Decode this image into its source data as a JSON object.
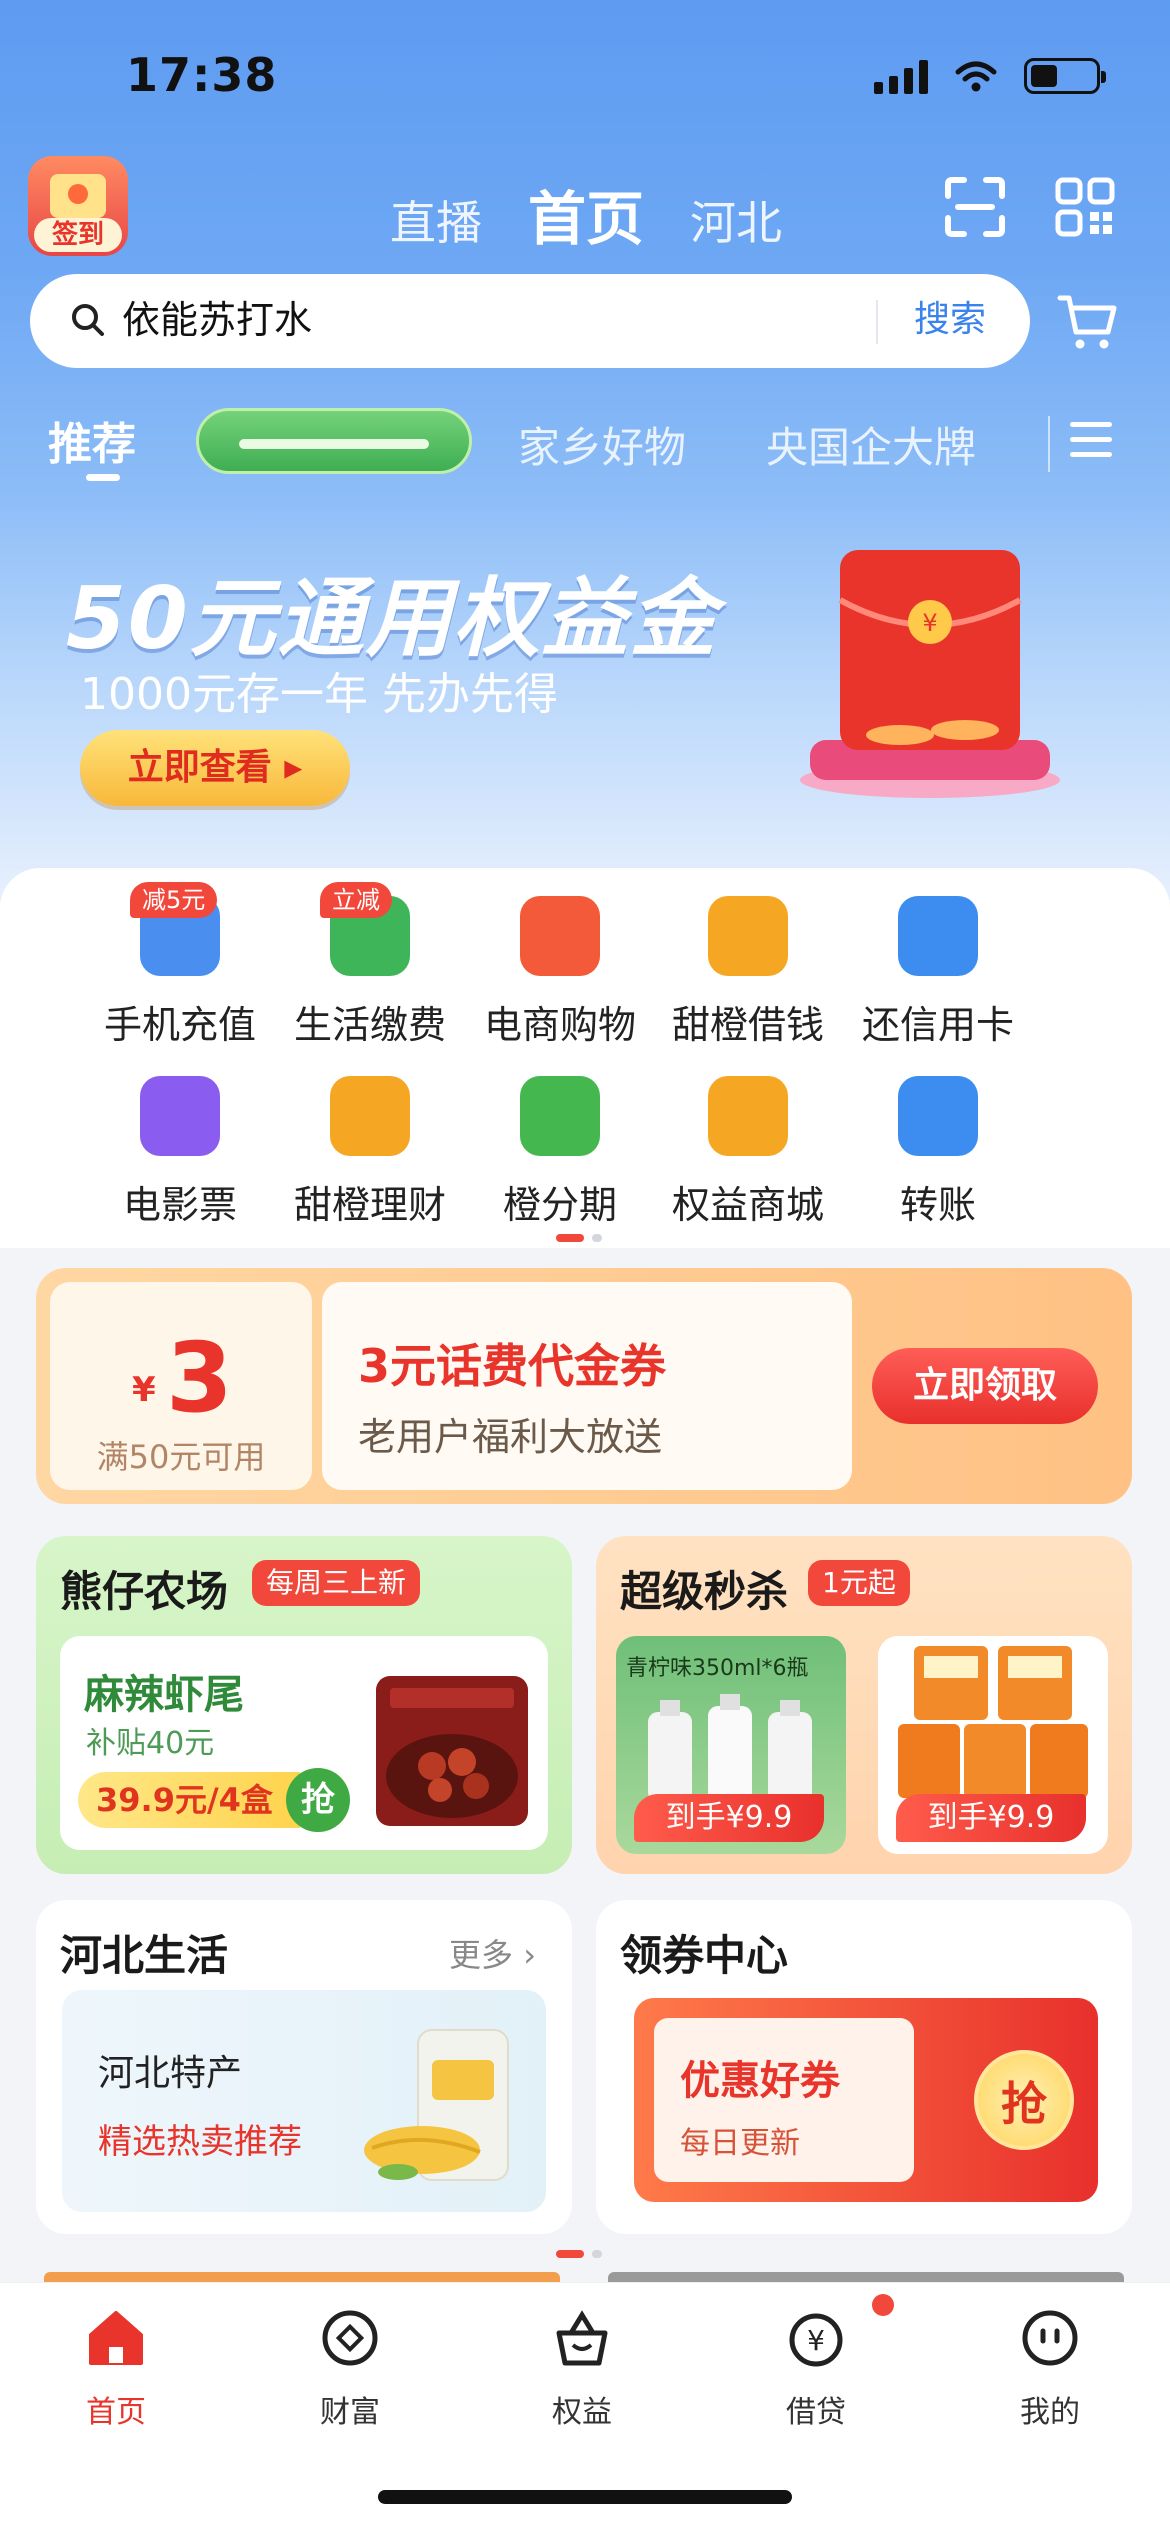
{
  "status": {
    "time": "17:38"
  },
  "header": {
    "signin_label": "签到",
    "tabs": [
      "直播",
      "首页",
      "河北"
    ],
    "active_tab": "首页"
  },
  "search": {
    "query": "依能苏打水",
    "button": "搜索"
  },
  "categories": {
    "active": "推荐",
    "items": [
      "家乡好物",
      "央国企大牌"
    ]
  },
  "banner": {
    "title": "50元通用权益金",
    "subtitle": "1000元存一年 先办先得",
    "button": "立即查看 ▸"
  },
  "services": [
    {
      "label": "手机充值",
      "badge": "减5元",
      "icon": "phone-icon",
      "color": "#4a8ef0"
    },
    {
      "label": "生活缴费",
      "badge": "立减",
      "icon": "lightning-icon",
      "color": "#3fb55a"
    },
    {
      "label": "电商购物",
      "badge": "",
      "icon": "shopping-bag-icon",
      "color": "#f25a3a"
    },
    {
      "label": "甜橙借钱",
      "badge": "",
      "icon": "borrow-icon",
      "color": "#f5a623"
    },
    {
      "label": "还信用卡",
      "badge": "",
      "icon": "credit-card-icon",
      "color": "#3d8cf0"
    },
    {
      "label": "电影票",
      "badge": "",
      "icon": "film-icon",
      "color": "#8b5cf0"
    },
    {
      "label": "甜橙理财",
      "badge": "",
      "icon": "coin-hand-icon",
      "color": "#f5a623"
    },
    {
      "label": "橙分期",
      "badge": "",
      "icon": "timer-icon",
      "color": "#44b84f"
    },
    {
      "label": "权益商城",
      "badge": "",
      "icon": "crown-icon",
      "color": "#f5a623"
    },
    {
      "label": "转账",
      "badge": "",
      "icon": "transfer-icon",
      "color": "#3d8cf0"
    }
  ],
  "coupon": {
    "currency": "¥",
    "amount": "3",
    "condition": "满50元可用",
    "title": "3元话费代金券",
    "subtitle": "老用户福利大放送",
    "button": "立即领取"
  },
  "farm": {
    "title": "熊仔农场",
    "tag": "每周三上新",
    "product": "麻辣虾尾",
    "subsidy": "补贴40元",
    "price": "39.9元/4盒",
    "grab": "抢"
  },
  "flash": {
    "title": "超级秒杀",
    "tag": "1元起",
    "product1_flavor": "青柠味350ml*6瓶",
    "product1_price": "到手¥9.9",
    "product2_price": "到手¥9.9"
  },
  "hebei": {
    "title": "河北生活",
    "more": "更多 ›",
    "item_title": "河北特产",
    "item_sub": "精选热卖推荐"
  },
  "voucher": {
    "title": "领券中心",
    "item_title": "优惠好券",
    "item_sub": "每日更新",
    "grab": "抢"
  },
  "tabbar": [
    {
      "label": "首页",
      "icon": "home-icon",
      "active": true
    },
    {
      "label": "财富",
      "icon": "wealth-icon",
      "active": false
    },
    {
      "label": "权益",
      "icon": "gift-basket-icon",
      "active": false
    },
    {
      "label": "借贷",
      "icon": "loan-icon",
      "active": false
    },
    {
      "label": "我的",
      "icon": "profile-icon",
      "active": false
    }
  ],
  "colors": {
    "accent": "#e8342a",
    "header": "#6ea8f4",
    "link": "#3a83ee"
  }
}
